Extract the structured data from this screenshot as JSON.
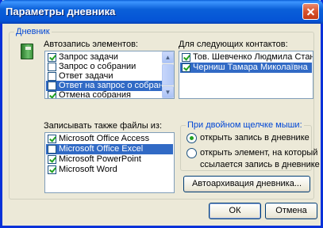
{
  "window": {
    "title": "Параметры дневника"
  },
  "journal_group": {
    "legend": "Дневник"
  },
  "auto_items": {
    "label": "Автозапись элементов:",
    "items": [
      {
        "label": "Запрос задачи",
        "checked": true,
        "selected": false
      },
      {
        "label": "Запрос о собрании",
        "checked": false,
        "selected": false
      },
      {
        "label": "Ответ задачи",
        "checked": false,
        "selected": false
      },
      {
        "label": "Ответ на запрос о собрании",
        "checked": false,
        "selected": true
      },
      {
        "label": "Отмена собрания",
        "checked": true,
        "selected": false
      }
    ]
  },
  "contacts": {
    "label": "Для следующих контактов:",
    "items": [
      {
        "label": "Тов. Шевченко Людмила Станісла",
        "checked": true,
        "selected": false
      },
      {
        "label": "Черниш Тамара Миколаївна",
        "checked": true,
        "selected": true
      }
    ]
  },
  "files": {
    "label": "Записывать также файлы из:",
    "items": [
      {
        "label": "Microsoft Office Access",
        "checked": true,
        "selected": false
      },
      {
        "label": "Microsoft Office Excel",
        "checked": false,
        "selected": true
      },
      {
        "label": "Microsoft PowerPoint",
        "checked": true,
        "selected": false
      },
      {
        "label": "Microsoft Word",
        "checked": true,
        "selected": false
      }
    ]
  },
  "dblclick": {
    "legend": "При двойном щелчке мыши:",
    "option1": "открыть запись в дневнике",
    "option2_line1": "открыть элемент, на который",
    "option2_line2": "ссылается запись в дневнике",
    "selected": 1
  },
  "buttons": {
    "autoarchive": "Автоархивация дневника...",
    "ok": "ОК",
    "cancel": "Отмена"
  }
}
